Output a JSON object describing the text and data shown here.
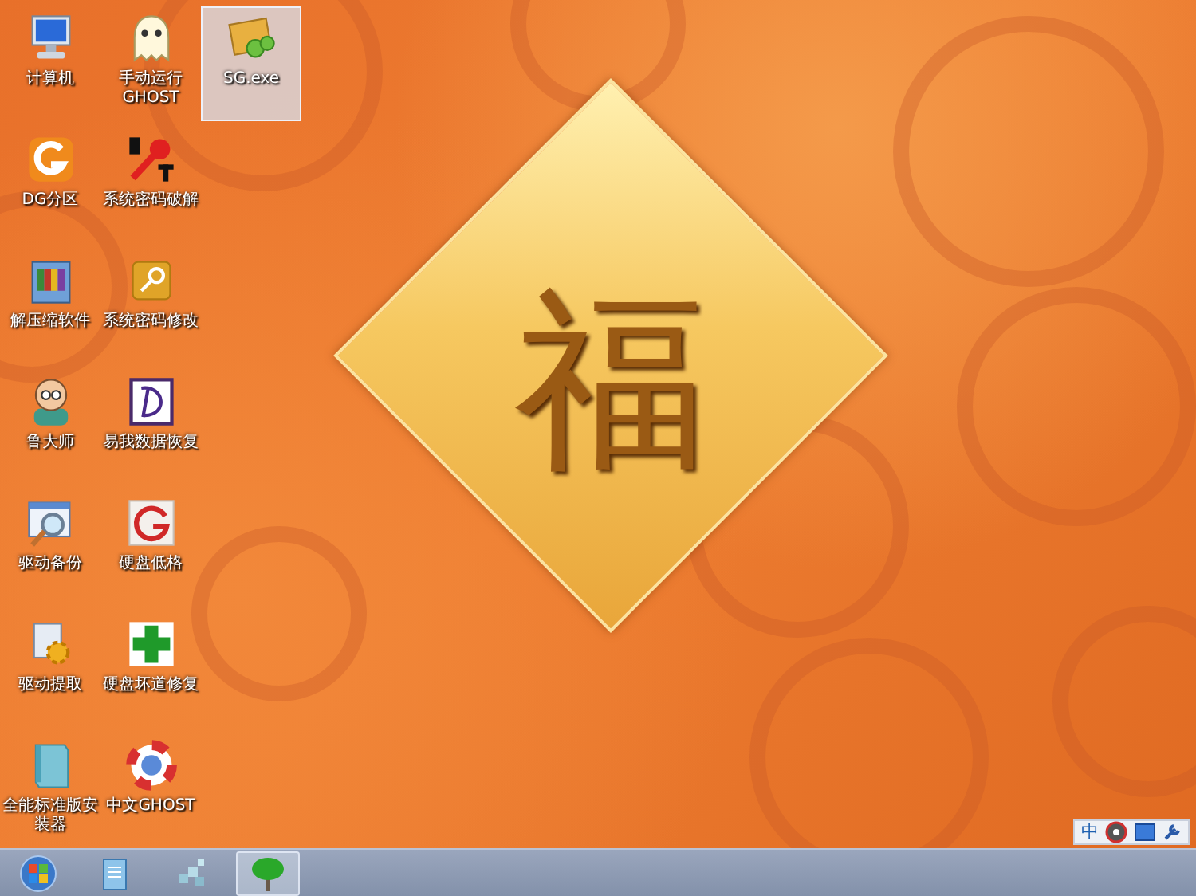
{
  "desktop": {
    "icons": [
      {
        "label": "计算机",
        "selected": false
      },
      {
        "label": "DG分区",
        "selected": false
      },
      {
        "label": "解压缩软件",
        "selected": false
      },
      {
        "label": "鲁大师",
        "selected": false
      },
      {
        "label": "驱动备份",
        "selected": false
      },
      {
        "label": "驱动提取",
        "selected": false
      },
      {
        "label": "全能标准版安装器",
        "selected": false
      },
      {
        "label": "手动运行GHOST",
        "selected": false
      },
      {
        "label": "系统密码破解",
        "selected": false
      },
      {
        "label": "系统密码修改",
        "selected": false
      },
      {
        "label": "易我数据恢复",
        "selected": false
      },
      {
        "label": "硬盘低格",
        "selected": false
      },
      {
        "label": "硬盘坏道修复",
        "selected": false
      },
      {
        "label": "中文GHOST",
        "selected": false
      },
      {
        "label": "SG.exe",
        "selected": true
      }
    ]
  },
  "wallpaper": {
    "character": "福"
  },
  "language_bar": {
    "label": "中"
  },
  "taskbar": {
    "buttons": [
      {
        "selected": false
      },
      {
        "selected": false
      },
      {
        "selected": true
      }
    ]
  }
}
